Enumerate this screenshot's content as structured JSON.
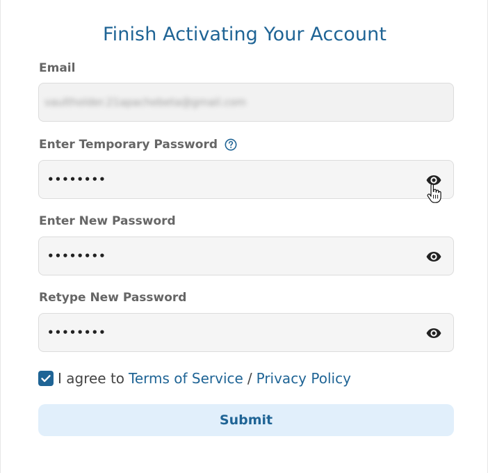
{
  "form": {
    "title": "Finish Activating Your Account",
    "email": {
      "label": "Email",
      "value": "vaultholder.21apachebeta@gmail.com"
    },
    "temp_password": {
      "label": "Enter Temporary Password",
      "value": "••••••••",
      "help_icon": "question-circle-icon",
      "toggle_icon": "eye-icon"
    },
    "new_password": {
      "label": "Enter New Password",
      "value": "••••••••",
      "toggle_icon": "eye-icon"
    },
    "retype_password": {
      "label": "Retype New Password",
      "value": "••••••••",
      "toggle_icon": "eye-icon"
    },
    "agree": {
      "checked": true,
      "prefix": "I agree to",
      "terms_link": "Terms of Service",
      "separator": "/",
      "privacy_link": "Privacy Policy"
    },
    "submit_label": "Submit"
  },
  "colors": {
    "accent": "#1f6495",
    "label": "#666666",
    "field_bg": "#f5f5f5",
    "submit_bg": "#e1effb"
  }
}
